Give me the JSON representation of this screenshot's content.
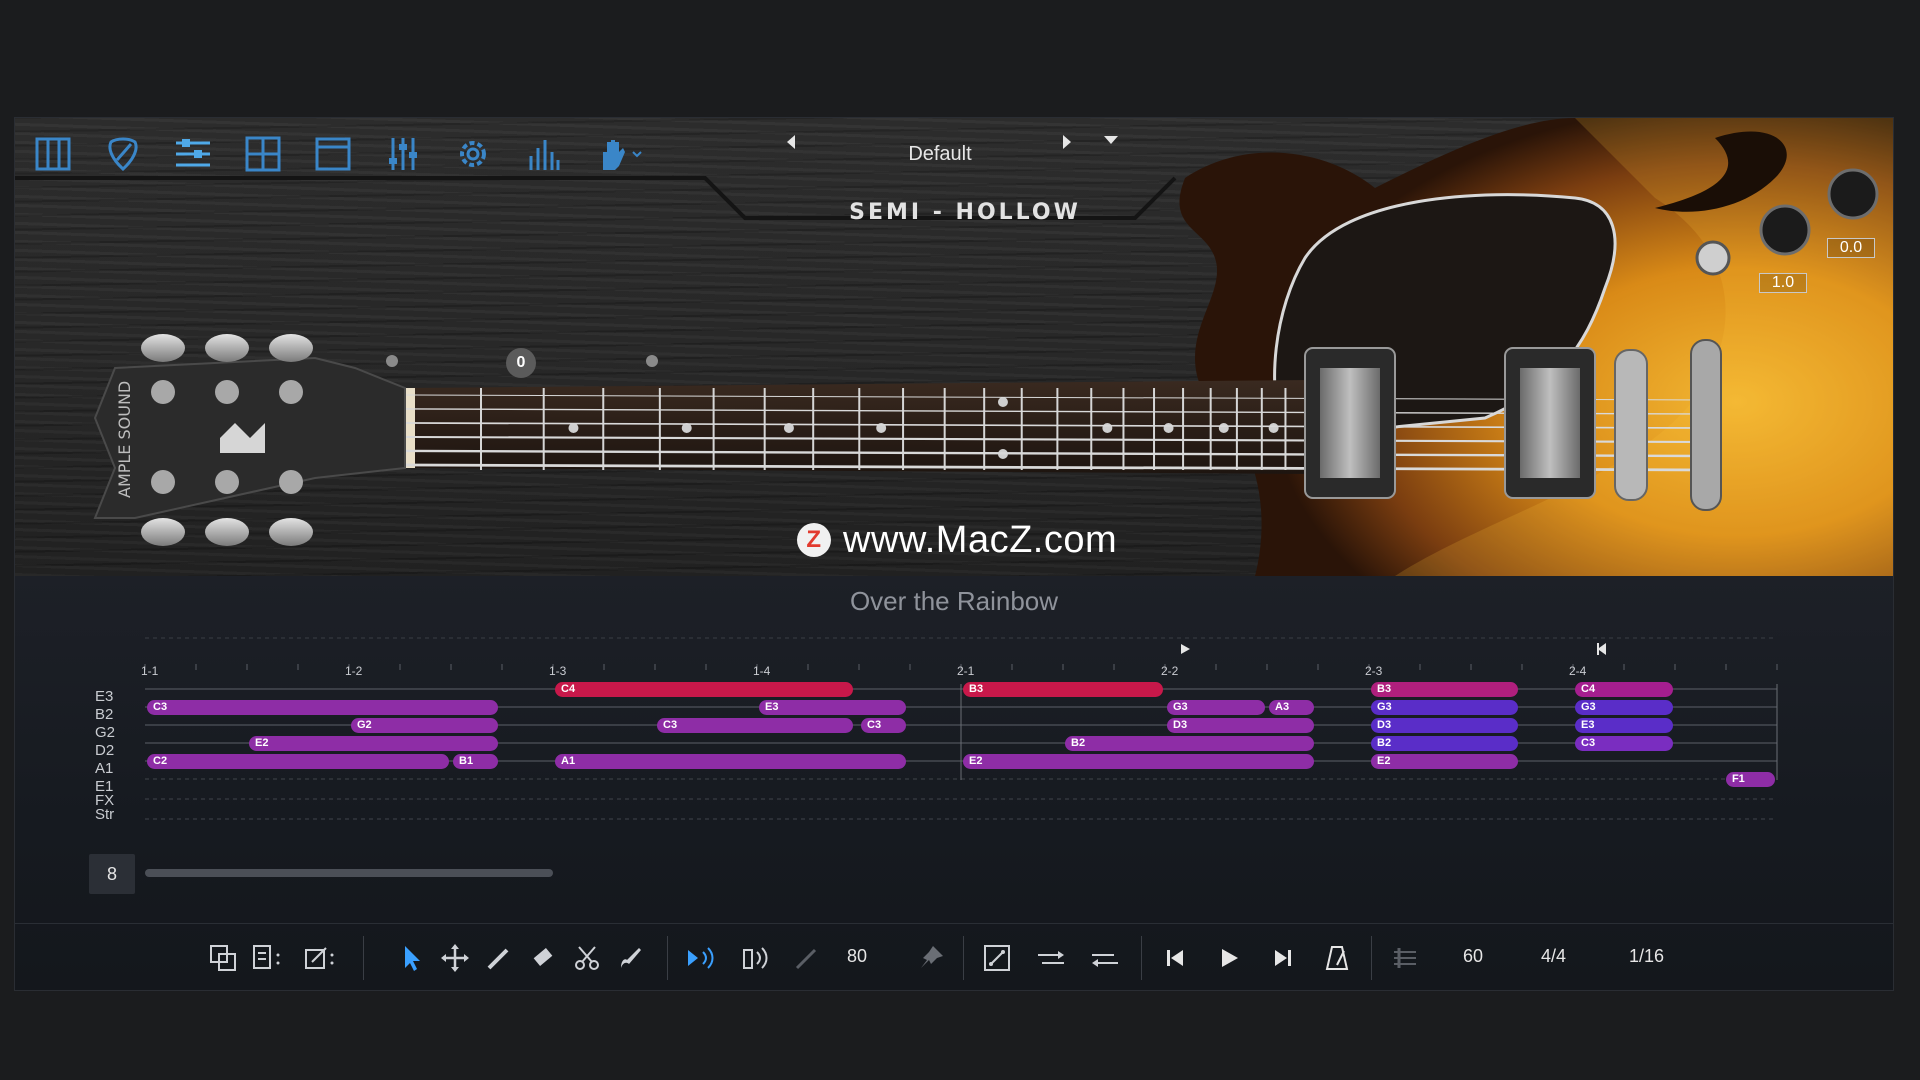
{
  "toolbar": {
    "icons": [
      {
        "name": "piano-keys-icon",
        "color": "#3a86c8"
      },
      {
        "name": "guitar-pick-icon",
        "color": "#3a86c8"
      },
      {
        "name": "strummer-icon",
        "color": "#4fa9e8",
        "active": true
      },
      {
        "name": "chord-grid-icon",
        "color": "#3a86c8"
      },
      {
        "name": "window-icon",
        "color": "#3a86c8"
      },
      {
        "name": "mixer-sliders-icon",
        "color": "#3a86c8"
      },
      {
        "name": "gear-icon",
        "color": "#3a86c8"
      },
      {
        "name": "eq-bars-icon",
        "color": "#3a86c8"
      },
      {
        "name": "hand-icon",
        "color": "#3a86c8"
      }
    ]
  },
  "preset": {
    "name": "Default"
  },
  "instrument": {
    "title": "SEMI - HOLLOW"
  },
  "fretboard": {
    "capo_value": "0"
  },
  "knobs": {
    "tone": "1.0",
    "volume": "0.0"
  },
  "watermark": {
    "text": "www.MacZ.com",
    "icon_letter": "Z"
  },
  "sequencer": {
    "song_title": "Over the Rainbow",
    "bars": [
      "1-1",
      "1-2",
      "1-3",
      "1-4",
      "2-1",
      "2-2",
      "2-3",
      "2-4"
    ],
    "tracks": [
      "E3",
      "B2",
      "G2",
      "D2",
      "A1",
      "E1",
      "FX",
      "Str"
    ],
    "notes": [
      {
        "label": "C4",
        "track": 0,
        "start": 1.0,
        "end": 1.74,
        "color": "#c8184a"
      },
      {
        "label": "B3",
        "track": 0,
        "start": 2.0,
        "end": 2.5,
        "color": "#c8184a"
      },
      {
        "label": "B3",
        "track": 0,
        "start": 3.0,
        "end": 3.37,
        "color": "#b01f7d"
      },
      {
        "label": "C4",
        "track": 0,
        "start": 3.5,
        "end": 3.75,
        "color": "#a51e8f"
      },
      {
        "label": "C3",
        "track": 1,
        "start": 0.0,
        "end": 0.87,
        "color": "#8e2da6"
      },
      {
        "label": "E3",
        "track": 1,
        "start": 1.5,
        "end": 1.87,
        "color": "#8e2da6"
      },
      {
        "label": "G3",
        "track": 1,
        "start": 2.5,
        "end": 2.75,
        "color": "#8e2da6"
      },
      {
        "label": "A3",
        "track": 1,
        "start": 2.75,
        "end": 2.87,
        "color": "#8e2da6"
      },
      {
        "label": "G3",
        "track": 1,
        "start": 3.0,
        "end": 3.37,
        "color": "#5a2dc8"
      },
      {
        "label": "G3",
        "track": 1,
        "start": 3.5,
        "end": 3.75,
        "color": "#5a2dc8"
      },
      {
        "label": "G2",
        "track": 2,
        "start": 0.5,
        "end": 0.87,
        "color": "#8e2da6"
      },
      {
        "label": "C3",
        "track": 2,
        "start": 1.25,
        "end": 1.74,
        "color": "#8e2da6"
      },
      {
        "label": "C3",
        "track": 2,
        "start": 1.75,
        "end": 1.87,
        "color": "#8e2da6"
      },
      {
        "label": "D3",
        "track": 2,
        "start": 2.5,
        "end": 2.87,
        "color": "#8e2da6"
      },
      {
        "label": "D3",
        "track": 2,
        "start": 3.0,
        "end": 3.37,
        "color": "#5a2dc8"
      },
      {
        "label": "E3",
        "track": 2,
        "start": 3.5,
        "end": 3.75,
        "color": "#5a2dc8"
      },
      {
        "label": "E2",
        "track": 3,
        "start": 0.25,
        "end": 0.87,
        "color": "#8e2da6"
      },
      {
        "label": "B2",
        "track": 3,
        "start": 2.25,
        "end": 2.87,
        "color": "#8e2da6"
      },
      {
        "label": "B2",
        "track": 3,
        "start": 3.0,
        "end": 3.37,
        "color": "#5a2dc8"
      },
      {
        "label": "C3",
        "track": 3,
        "start": 3.5,
        "end": 3.75,
        "color": "#7a2dc0"
      },
      {
        "label": "C2",
        "track": 4,
        "start": 0.0,
        "end": 0.75,
        "color": "#8e2da6"
      },
      {
        "label": "B1",
        "track": 4,
        "start": 0.75,
        "end": 0.87,
        "color": "#8e2da6"
      },
      {
        "label": "A1",
        "track": 4,
        "start": 1.0,
        "end": 1.87,
        "color": "#8e2da6"
      },
      {
        "label": "E2",
        "track": 4,
        "start": 2.0,
        "end": 2.87,
        "color": "#8e2da6"
      },
      {
        "label": "E2",
        "track": 4,
        "start": 3.0,
        "end": 3.37,
        "color": "#8e2da6"
      },
      {
        "label": "F1",
        "track": 5,
        "start": 3.87,
        "end": 4.0,
        "color": "#8e2da6"
      }
    ],
    "bar_count": "8"
  },
  "transport": {
    "velocity": "80",
    "tempo": "60",
    "time_signature": "4/4",
    "quantize": "1/16"
  }
}
